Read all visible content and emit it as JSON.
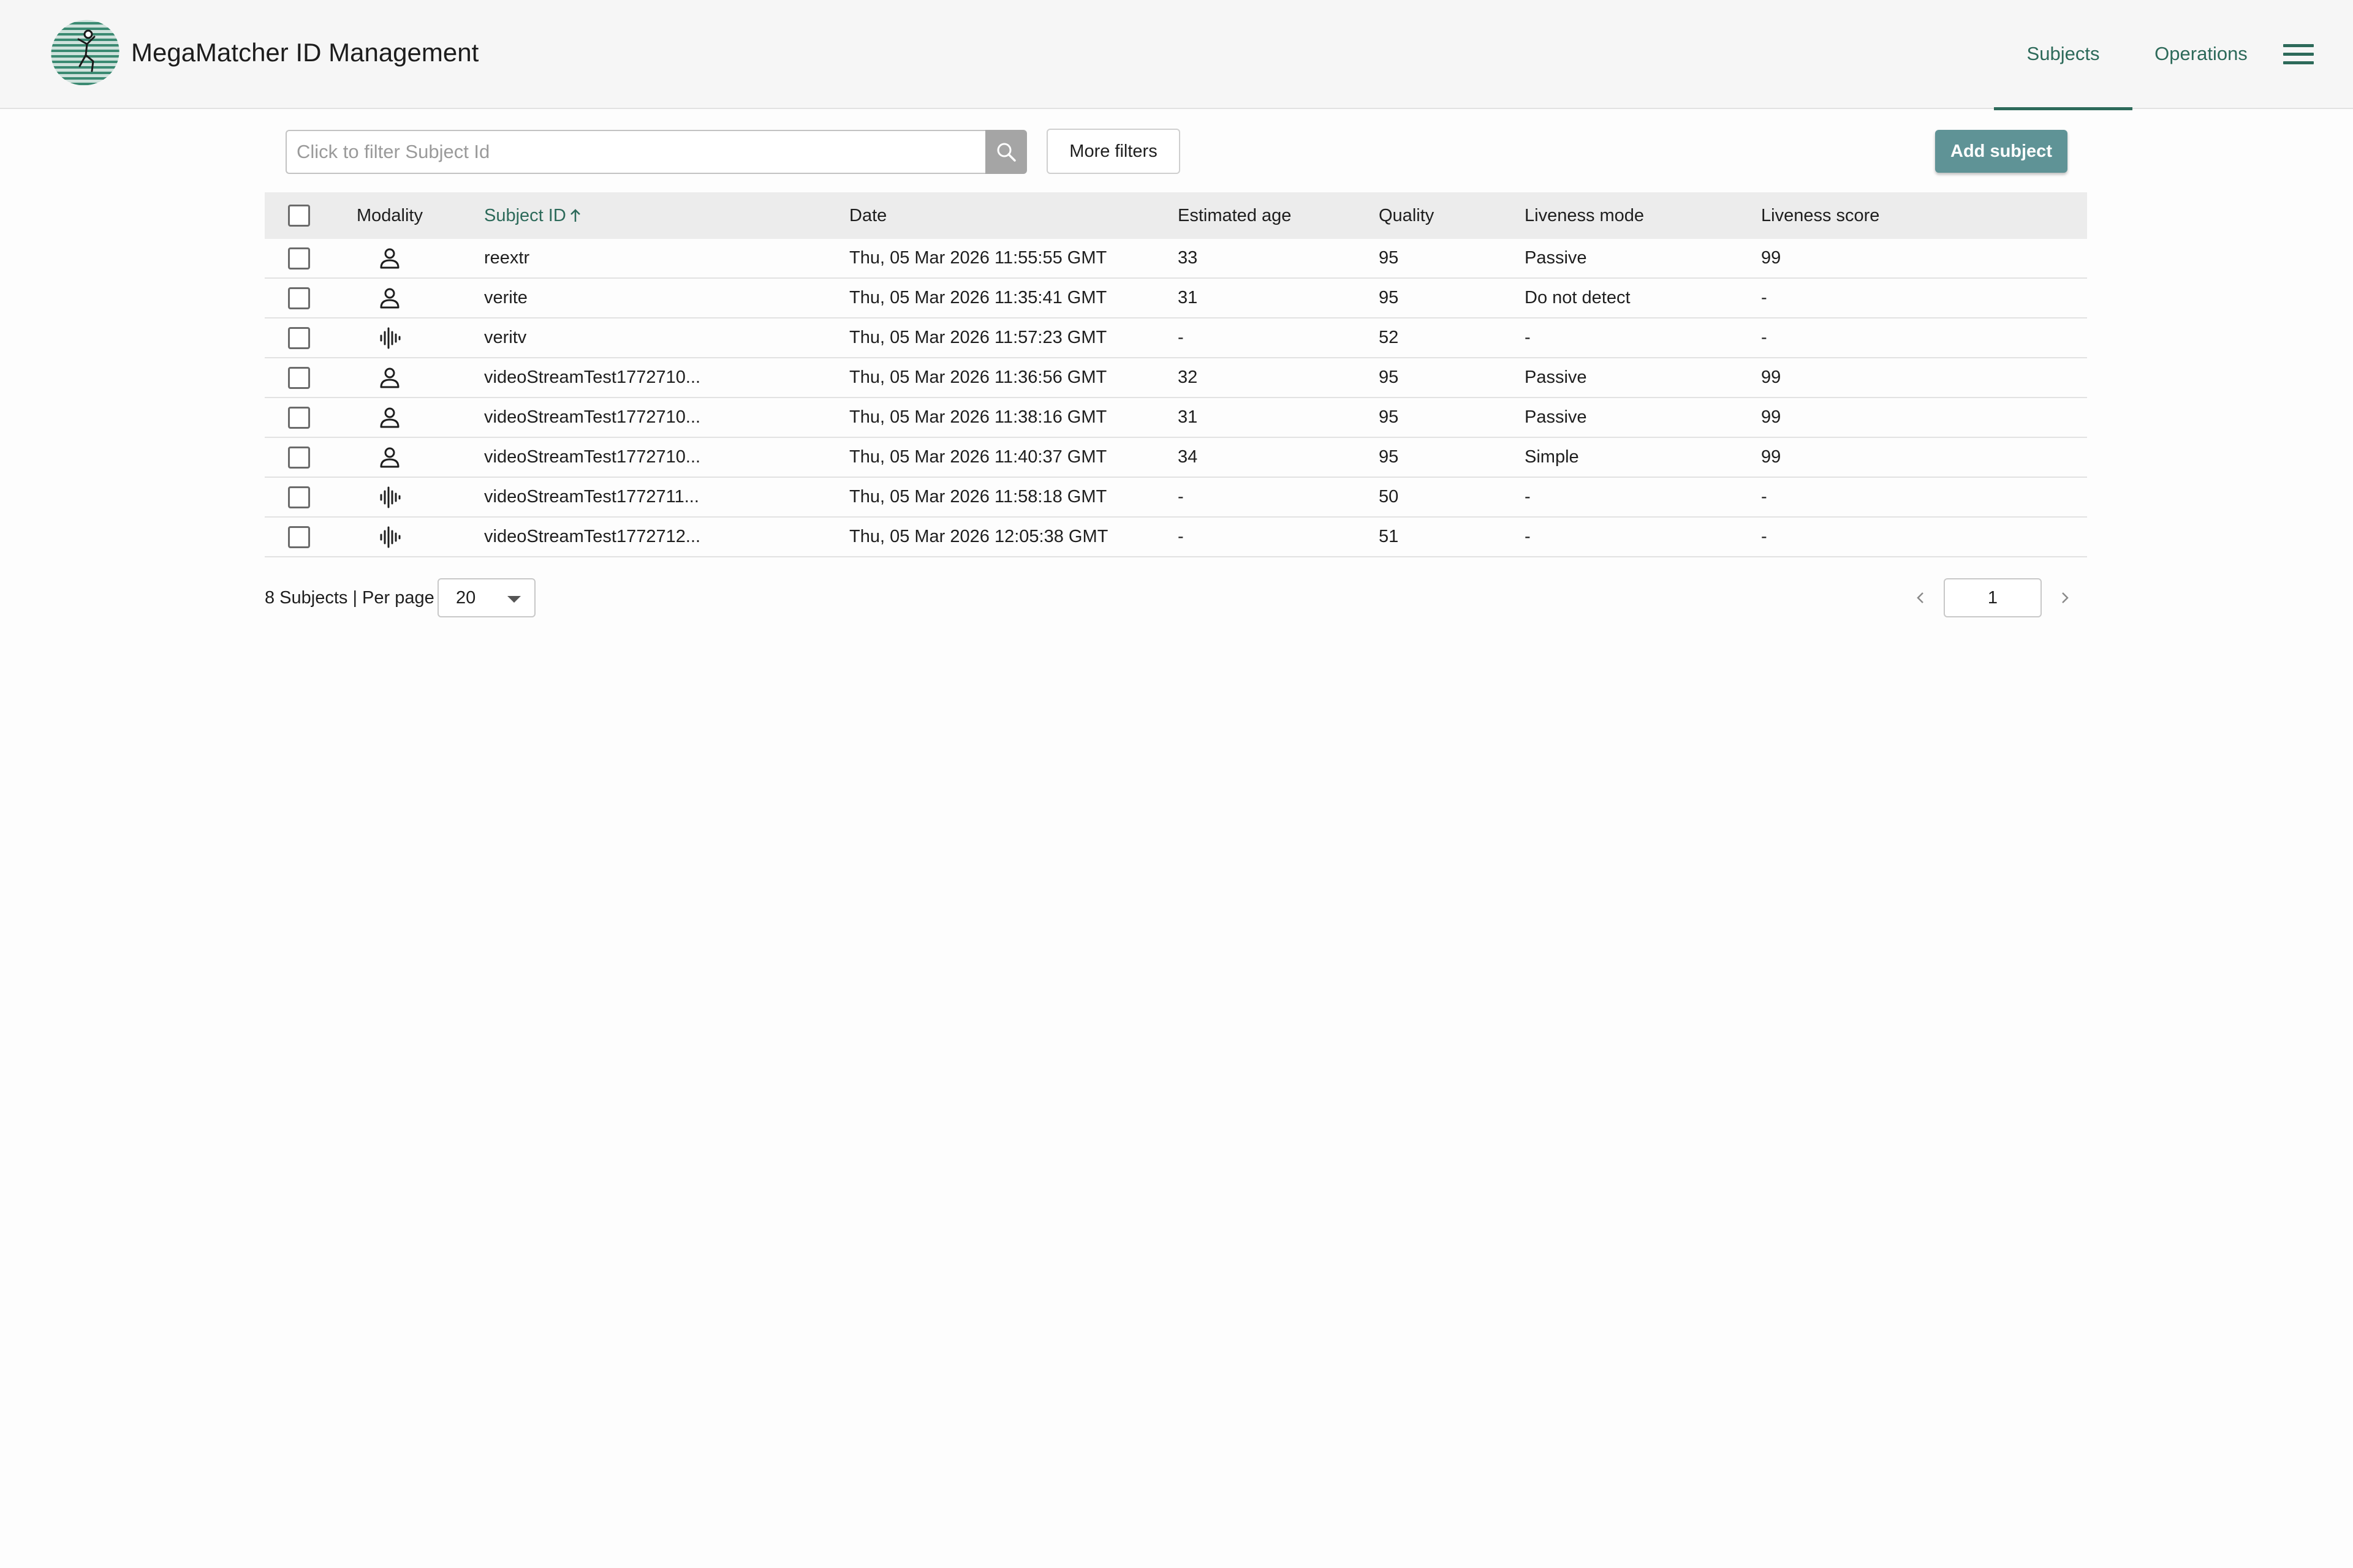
{
  "app": {
    "title": "MegaMatcher ID Management",
    "logo_icon": "runner-logo-icon",
    "accent_color": "#2d6a5a"
  },
  "nav": {
    "tabs": [
      {
        "label": "Subjects",
        "active": true
      },
      {
        "label": "Operations",
        "active": false
      }
    ],
    "menu_icon": "hamburger-menu-icon"
  },
  "toolbar": {
    "search_placeholder": "Click to filter Subject Id",
    "search_value": "",
    "more_filters_label": "More filters",
    "add_subject_label": "Add subject"
  },
  "table": {
    "columns": {
      "modality": "Modality",
      "subject_id": "Subject ID",
      "date": "Date",
      "estimated_age": "Estimated age",
      "quality": "Quality",
      "liveness_mode": "Liveness mode",
      "liveness_score": "Liveness score"
    },
    "sort": {
      "column": "subject_id",
      "direction": "ascending"
    },
    "rows": [
      {
        "modality": "face",
        "subject_id": "reextr",
        "date": "Thu, 05 Mar 2026 11:55:55 GMT",
        "estimated_age": "33",
        "quality": "95",
        "liveness_mode": "Passive",
        "liveness_score": "99"
      },
      {
        "modality": "face",
        "subject_id": "verite",
        "date": "Thu, 05 Mar 2026 11:35:41 GMT",
        "estimated_age": "31",
        "quality": "95",
        "liveness_mode": "Do not detect",
        "liveness_score": "-"
      },
      {
        "modality": "voice",
        "subject_id": "veritv",
        "date": "Thu, 05 Mar 2026 11:57:23 GMT",
        "estimated_age": "-",
        "quality": "52",
        "liveness_mode": "-",
        "liveness_score": "-"
      },
      {
        "modality": "face",
        "subject_id": "videoStreamTest1772710...",
        "date": "Thu, 05 Mar 2026 11:36:56 GMT",
        "estimated_age": "32",
        "quality": "95",
        "liveness_mode": "Passive",
        "liveness_score": "99"
      },
      {
        "modality": "face",
        "subject_id": "videoStreamTest1772710...",
        "date": "Thu, 05 Mar 2026 11:38:16 GMT",
        "estimated_age": "31",
        "quality": "95",
        "liveness_mode": "Passive",
        "liveness_score": "99"
      },
      {
        "modality": "face",
        "subject_id": "videoStreamTest1772710...",
        "date": "Thu, 05 Mar 2026 11:40:37 GMT",
        "estimated_age": "34",
        "quality": "95",
        "liveness_mode": "Simple",
        "liveness_score": "99"
      },
      {
        "modality": "voice",
        "subject_id": "videoStreamTest1772711...",
        "date": "Thu, 05 Mar 2026 11:58:18 GMT",
        "estimated_age": "-",
        "quality": "50",
        "liveness_mode": "-",
        "liveness_score": "-"
      },
      {
        "modality": "voice",
        "subject_id": "videoStreamTest1772712...",
        "date": "Thu, 05 Mar 2026 12:05:38 GMT",
        "estimated_age": "-",
        "quality": "51",
        "liveness_mode": "-",
        "liveness_score": "-"
      }
    ]
  },
  "footer": {
    "subjects_count_label": "8 Subjects | Per page",
    "per_page_value": "20",
    "current_page": "1"
  }
}
